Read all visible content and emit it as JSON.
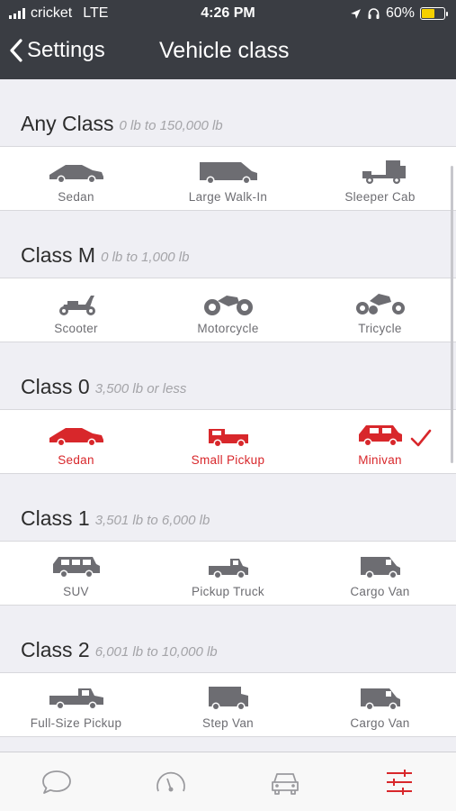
{
  "status": {
    "carrier": "cricket",
    "network": "LTE",
    "time": "4:26 PM",
    "battery": "60%",
    "battery_level": 0.6
  },
  "nav": {
    "back_label": "Settings",
    "title": "Vehicle class"
  },
  "colors": {
    "selected": "#d8272b",
    "icon": "#6d6d72",
    "bar": "#3a3d43"
  },
  "sections": [
    {
      "title": "Any Class",
      "range": "0 lb to 150,000 lb",
      "items": [
        {
          "label": "Sedan",
          "icon": "sedan-icon"
        },
        {
          "label": "Large Walk-In",
          "icon": "large-walk-in-icon"
        },
        {
          "label": "Sleeper Cab",
          "icon": "sleeper-cab-icon"
        }
      ]
    },
    {
      "title": "Class M",
      "range": "0 lb to 1,000 lb",
      "items": [
        {
          "label": "Scooter",
          "icon": "scooter-icon"
        },
        {
          "label": "Motorcycle",
          "icon": "motorcycle-icon"
        },
        {
          "label": "Tricycle",
          "icon": "tricycle-icon"
        }
      ]
    },
    {
      "title": "Class 0",
      "range": "3,500 lb or less",
      "items": [
        {
          "label": "Sedan",
          "icon": "sedan-icon"
        },
        {
          "label": "Small Pickup",
          "icon": "small-pickup-icon"
        },
        {
          "label": "Minivan",
          "icon": "minivan-icon"
        }
      ]
    },
    {
      "title": "Class 1",
      "range": "3,501 lb to 6,000 lb",
      "items": [
        {
          "label": "SUV",
          "icon": "suv-icon"
        },
        {
          "label": "Pickup Truck",
          "icon": "pickup-truck-icon"
        },
        {
          "label": "Cargo Van",
          "icon": "cargo-van-icon"
        }
      ]
    },
    {
      "title": "Class 2",
      "range": "6,001 lb to 10,000 lb",
      "items": [
        {
          "label": "Full-Size Pickup",
          "icon": "full-size-pickup-icon"
        },
        {
          "label": "Step Van",
          "icon": "step-van-icon"
        },
        {
          "label": "Cargo Van",
          "icon": "cargo-van-icon"
        }
      ]
    }
  ],
  "selected_section": "Class 0",
  "tabs": [
    {
      "icon": "chat-icon"
    },
    {
      "icon": "speedometer-icon"
    },
    {
      "icon": "car-icon"
    },
    {
      "icon": "settings-sliders-icon",
      "active": true
    }
  ]
}
